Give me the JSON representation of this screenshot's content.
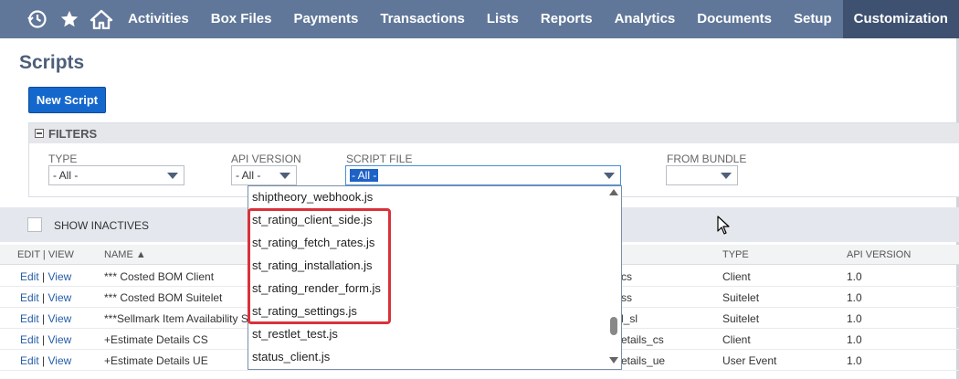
{
  "nav": {
    "items": [
      "Activities",
      "Box Files",
      "Payments",
      "Transactions",
      "Lists",
      "Reports",
      "Analytics",
      "Documents",
      "Setup",
      "Customization"
    ],
    "active_index": 9,
    "icons": [
      "recent-clock-icon",
      "star-icon",
      "home-icon"
    ]
  },
  "page": {
    "title": "Scripts",
    "new_button": "New Script"
  },
  "filters": {
    "header": "FILTERS",
    "type": {
      "label": "TYPE",
      "value": "- All -"
    },
    "api_version": {
      "label": "API VERSION",
      "value": "- All -"
    },
    "script_file": {
      "label": "SCRIPT FILE",
      "value": "- All -"
    },
    "from_bundle": {
      "label": "FROM BUNDLE",
      "value": ""
    }
  },
  "show_inactives": "SHOW INACTIVES",
  "table": {
    "headers": {
      "edit_view": "EDIT | VIEW",
      "name": "NAME ▲",
      "type": "TYPE",
      "api_version": "API VERSION"
    },
    "rows": [
      {
        "edit": "Edit",
        "view": "View",
        "name": "*** Costed BOM Client",
        "file": "cs",
        "type": "Client",
        "api": "1.0"
      },
      {
        "edit": "Edit",
        "view": "View",
        "name": "*** Costed BOM Suitelet",
        "file": "ss",
        "type": "Suitelet",
        "api": "1.0"
      },
      {
        "edit": "Edit",
        "view": "View",
        "name": "***Sellmark Item Availability S",
        "file": "l_sl",
        "type": "Suitelet",
        "api": "1.0"
      },
      {
        "edit": "Edit",
        "view": "View",
        "name": "+Estimate Details CS",
        "file": "etails_cs",
        "type": "Client",
        "api": "1.0"
      },
      {
        "edit": "Edit",
        "view": "View",
        "name": "+Estimate Details UE",
        "file": "etails_ue",
        "type": "User Event",
        "api": "1.0"
      }
    ]
  },
  "dropdown": {
    "options": [
      "shiptheory_webhook.js",
      "st_rating_client_side.js",
      "st_rating_fetch_rates.js",
      "st_rating_installation.js",
      "st_rating_render_form.js",
      "st_rating_settings.js",
      "st_restlet_test.js",
      "status_client.js"
    ]
  },
  "colors": {
    "nav_bg": "#607799",
    "nav_active": "#3f5170",
    "primary_button": "#1467cc",
    "highlight_border": "#d9323a"
  }
}
